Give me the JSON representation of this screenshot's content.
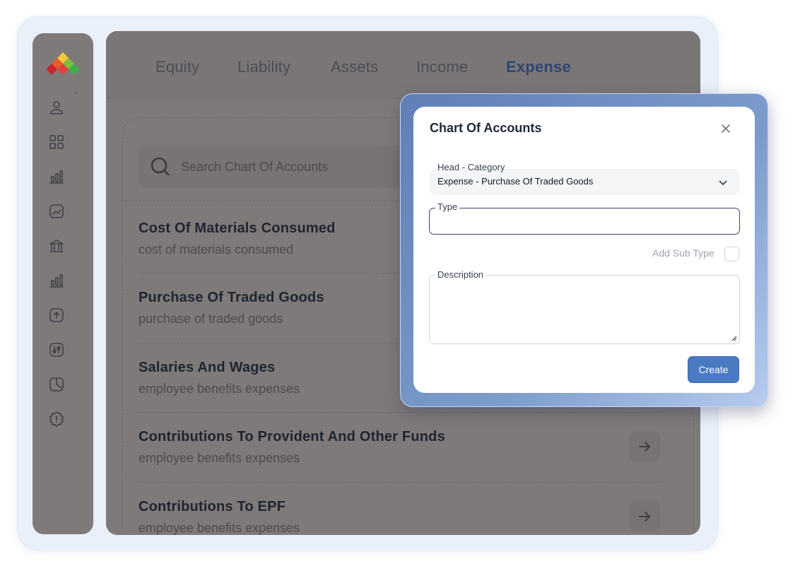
{
  "tabs": [
    {
      "label": "Equity",
      "active": false
    },
    {
      "label": "Liability",
      "active": false
    },
    {
      "label": "Assets",
      "active": false
    },
    {
      "label": "Income",
      "active": false
    },
    {
      "label": "Expense",
      "active": true
    }
  ],
  "search": {
    "placeholder": "Search Chart Of Accounts"
  },
  "accounts": [
    {
      "title": "Cost Of Materials Consumed",
      "subtitle": "cost of materials consumed"
    },
    {
      "title": "Purchase Of Traded Goods",
      "subtitle": "purchase of traded goods"
    },
    {
      "title": "Salaries And Wages",
      "subtitle": "employee benefits expenses"
    },
    {
      "title": "Contributions To Provident And Other Funds",
      "subtitle": "employee benefits expenses"
    },
    {
      "title": "Contributions To EPF",
      "subtitle": "employee benefits expenses"
    }
  ],
  "sidebar": {
    "icons": [
      "user-icon",
      "grid-icon",
      "bar-chart-icon",
      "trend-chart-icon",
      "bank-icon",
      "bar-chart-icon",
      "upload-icon",
      "sliders-icon",
      "report-icon",
      "alert-badge-icon"
    ]
  },
  "modal": {
    "title": "Chart Of Accounts",
    "head_category_label": "Head - Category",
    "head_category_value": "Expense - Purchase Of Traded Goods",
    "type_label": "Type",
    "type_value": "",
    "add_sub_type_label": "Add Sub Type",
    "description_label": "Description",
    "description_value": "",
    "create_label": "Create"
  },
  "colors": {
    "accent": "#4a7ac2",
    "active_tab": "#2e4674",
    "overlay": "#7f7a7a"
  }
}
